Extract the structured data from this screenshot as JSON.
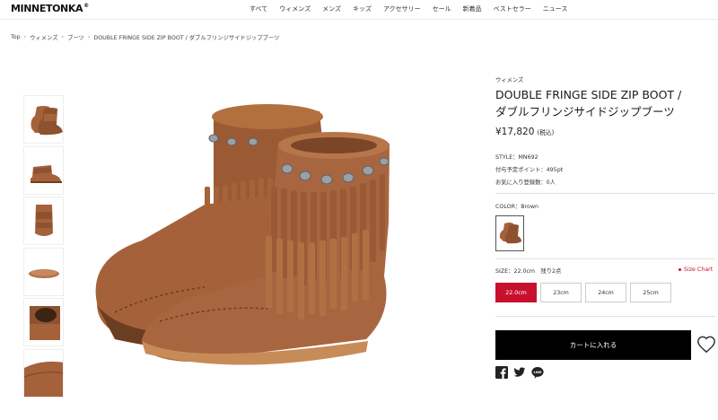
{
  "brand": {
    "logo_text": "MINNETONKA",
    "logo_mark": "®"
  },
  "nav": {
    "items": [
      "すべて",
      "ウィメンズ",
      "メンズ",
      "キッズ",
      "アクセサリー",
      "セール",
      "新着品",
      "ベストセラー",
      "ニュース"
    ]
  },
  "breadcrumb": [
    "Top",
    "ウィメンズ",
    "ブーツ",
    "DOUBLE FRINGE SIDE ZIP BOOT / ダブルフリンジサイドジップブーツ"
  ],
  "product": {
    "category": "ウィメンズ",
    "title": "DOUBLE FRINGE SIDE ZIP BOOT / ダブルフリンジサイドジップブーツ",
    "price": "¥17,820",
    "price_tax": "(税込)",
    "style": "STYLE：MN692",
    "points": "付与予定ポイント：495pt",
    "favorites": "お気に入り登録数：0人",
    "color_label": "COLOR：Brown",
    "size_label": "SIZE：22.0cm　残り2点",
    "size_chart": "Size Chart",
    "sizes": [
      "22.0cm",
      "23cm",
      "24cm",
      "25cm"
    ],
    "cart_label": "カートに入れる"
  },
  "icons": {
    "favorite": "heart-icon",
    "facebook": "facebook-icon",
    "twitter": "twitter-icon",
    "line": "line-icon"
  },
  "colors": {
    "accent": "#c8102e",
    "cart_button": "#000000",
    "suede": "#a5623a"
  }
}
